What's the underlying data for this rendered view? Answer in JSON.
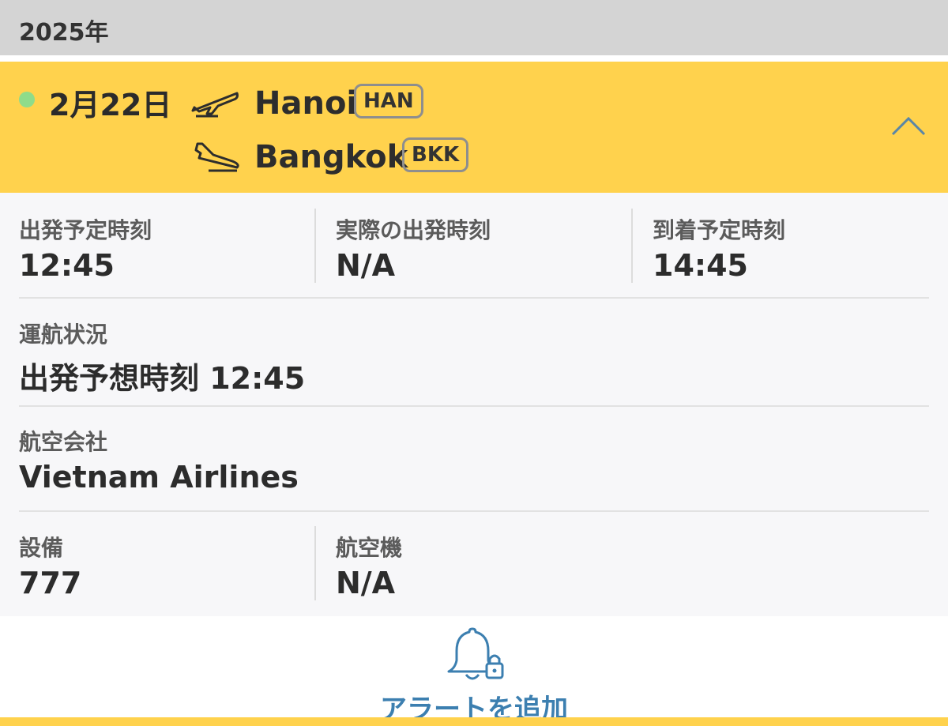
{
  "header": {
    "year": "2025年"
  },
  "flight": {
    "date": "2月22日",
    "status_color": "#8fdc8a",
    "departure": {
      "city": "Hanoi",
      "code": "HAN",
      "icon": "plane-takeoff-icon"
    },
    "arrival": {
      "city": "Bangkok",
      "code": "BKK",
      "icon": "plane-landing-icon"
    },
    "collapse_icon": "chevron-up-icon",
    "accent_color": "#ffd24d"
  },
  "details": {
    "sched_dep": {
      "label": "出発予定時刻",
      "value": "12:45"
    },
    "actual_dep": {
      "label": "実際の出発時刻",
      "value": "N/A"
    },
    "sched_arr": {
      "label": "到着予定時刻",
      "value": "14:45"
    },
    "status": {
      "label": "運航状況",
      "value": "出発予想時刻 12:45"
    },
    "airline": {
      "label": "航空会社",
      "value": "Vietnam Airlines"
    },
    "equipment": {
      "label": "設備",
      "value": "777"
    },
    "aircraft": {
      "label": "航空機",
      "value": "N/A"
    }
  },
  "alert": {
    "label": "アラートを追加",
    "icon": "bell-lock-icon",
    "color": "#3c7fb0"
  }
}
